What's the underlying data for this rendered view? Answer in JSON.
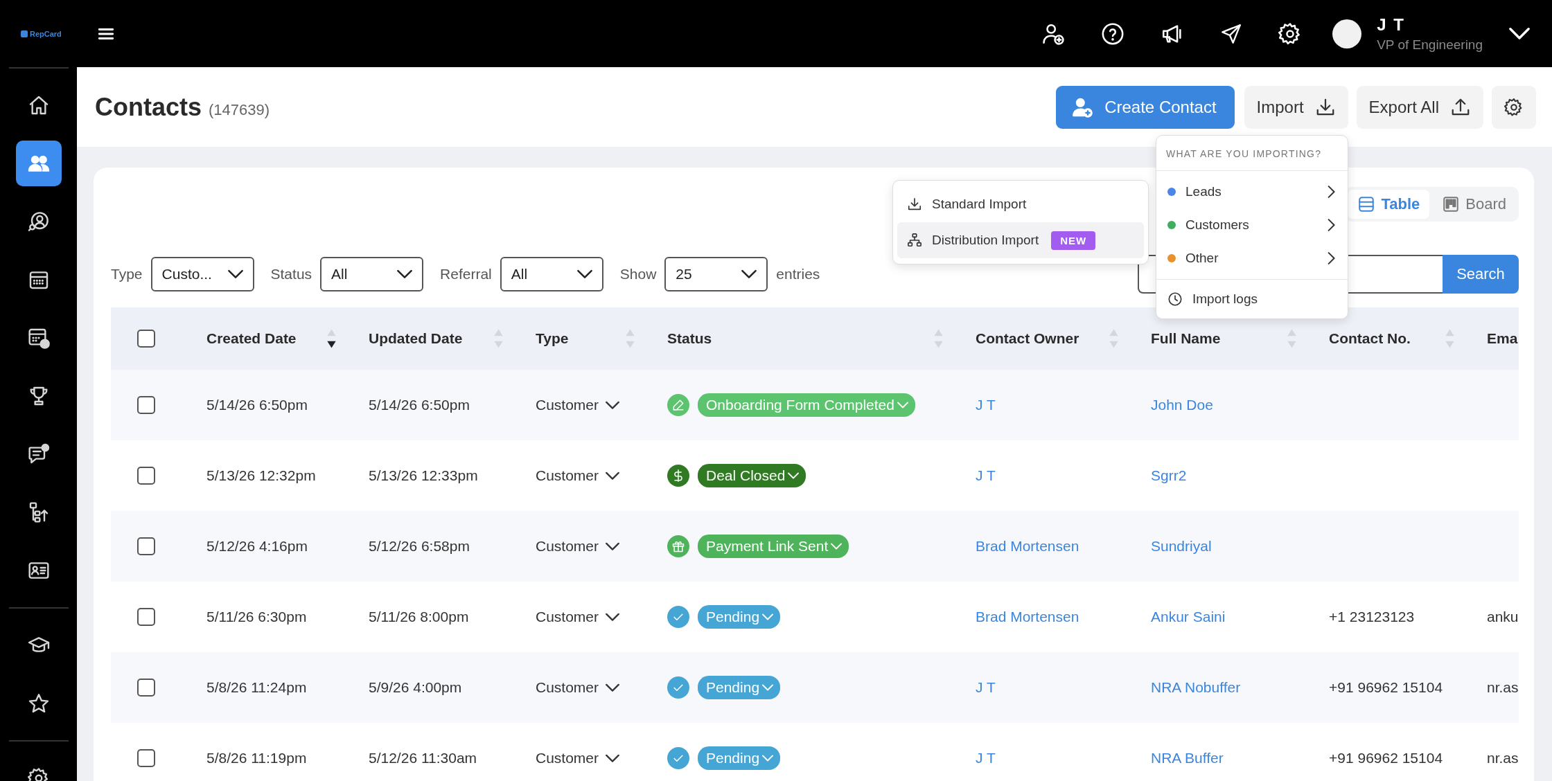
{
  "topbar": {
    "logo": "RepCard",
    "user": {
      "name": "J T",
      "role": "VP of Engineering"
    }
  },
  "sidebar": {
    "groups": [
      [
        {
          "selected": false
        },
        {
          "selected": true
        },
        {
          "selected": false
        },
        {
          "selected": false
        },
        {
          "selected": false
        },
        {
          "selected": false
        },
        {
          "selected": false
        },
        {
          "selected": false
        },
        {
          "selected": false
        }
      ],
      [
        {
          "selected": false
        },
        {
          "selected": false
        }
      ],
      [
        {
          "selected": false
        }
      ]
    ]
  },
  "page": {
    "title": "Contacts",
    "count": "(147639)"
  },
  "actions": [
    {
      "label": "Create Contact",
      "kind": "primary"
    },
    {
      "label": "Import",
      "kind": "import"
    },
    {
      "label": "Export All",
      "kind": "export"
    },
    {
      "kind": "settings"
    }
  ],
  "view_toggle": [
    {
      "label": "Table",
      "kind": "table",
      "selected": true
    },
    {
      "label": "Board",
      "kind": "board",
      "selected": false
    }
  ],
  "filters": [
    {
      "label": "Type",
      "value": "Custo..."
    },
    {
      "label": "Status",
      "value": "All"
    },
    {
      "label": "Referral",
      "value": "All"
    },
    {
      "label": "Show",
      "value": "25"
    }
  ],
  "entries_label": "entries",
  "search": {
    "button": "Search"
  },
  "import_menu": {
    "items": [
      {
        "label": "Standard Import",
        "kind": "standard",
        "selected": false
      },
      {
        "label": "Distribution Import",
        "kind": "distribution",
        "badge": "NEW",
        "selected": true
      }
    ]
  },
  "import_type_menu": {
    "heading": "WHAT ARE YOU IMPORTING?",
    "items": [
      {
        "label": "Leads",
        "color": "#4a86e8"
      },
      {
        "label": "Customers",
        "color": "#3fae5f"
      },
      {
        "label": "Other",
        "color": "#e8912d"
      }
    ],
    "footer": "Import logs"
  },
  "table": {
    "select_all": {
      "checked": false
    },
    "columns": [
      {
        "label": "Created Date",
        "sortable": true,
        "sorted_desc": true
      },
      {
        "label": "Updated Date",
        "sortable": true,
        "sorted_desc": false
      },
      {
        "label": "Type",
        "sortable": true,
        "sorted_desc": false
      },
      {
        "label": "Status",
        "sortable": true,
        "sorted_desc": false
      },
      {
        "label": "Contact Owner",
        "sortable": true,
        "sorted_desc": false
      },
      {
        "label": "Full Name",
        "sortable": true,
        "sorted_desc": false
      },
      {
        "label": "Contact No.",
        "sortable": true,
        "sorted_desc": false
      },
      {
        "label": "Ema",
        "sortable": false
      }
    ],
    "rows": [
      {
        "checked": false,
        "created": "5/14/26 6:50pm",
        "updated": "5/14/26 6:50pm",
        "type": "Customer",
        "status": {
          "label": "Onboarding Form Completed",
          "kind": "form",
          "color": "#5cc46e"
        },
        "owner": "J T",
        "name": "John Doe"
      },
      {
        "checked": false,
        "created": "5/13/26 12:32pm",
        "updated": "5/13/26 12:33pm",
        "type": "Customer",
        "status": {
          "label": "Deal Closed",
          "kind": "deal",
          "color": "#2f7a22"
        },
        "owner": "J T",
        "name": "Sgrr2"
      },
      {
        "checked": false,
        "created": "5/12/26 4:16pm",
        "updated": "5/12/26 6:58pm",
        "type": "Customer",
        "status": {
          "label": "Payment Link Sent",
          "kind": "payment",
          "color": "#4fb35c"
        },
        "owner": "Brad Mortensen",
        "name": "Sundriyal"
      },
      {
        "checked": false,
        "created": "5/11/26 6:30pm",
        "updated": "5/11/26 8:00pm",
        "type": "Customer",
        "status": {
          "label": "Pending",
          "kind": "pending",
          "color": "#45a6d6"
        },
        "owner": "Brad Mortensen",
        "name": "Ankur Saini",
        "phone": "+1 23123123",
        "email": "anku"
      },
      {
        "checked": false,
        "created": "5/8/26 11:24pm",
        "updated": "5/9/26 4:00pm",
        "type": "Customer",
        "status": {
          "label": "Pending",
          "kind": "pending",
          "color": "#45a6d6"
        },
        "owner": "J T",
        "name": "NRA Nobuffer",
        "phone": "+91 96962 15104",
        "email": "nr.as"
      },
      {
        "checked": false,
        "created": "5/8/26 11:19pm",
        "updated": "5/12/26 11:30am",
        "type": "Customer",
        "status": {
          "label": "Pending",
          "kind": "pending",
          "color": "#45a6d6"
        },
        "owner": "J T",
        "name": "NRA Buffer",
        "phone": "+91 96962 15104",
        "email": "nr.as"
      }
    ]
  }
}
